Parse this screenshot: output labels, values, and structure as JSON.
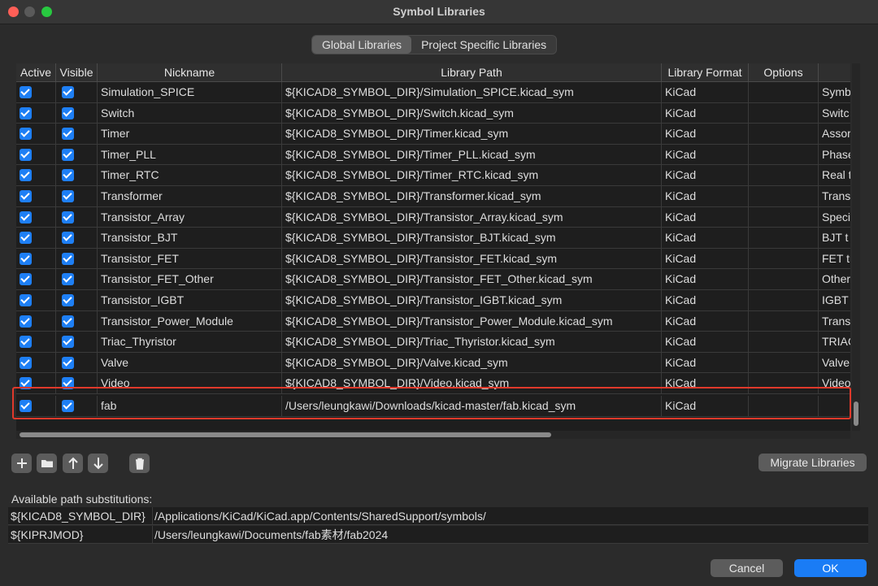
{
  "window": {
    "title": "Symbol Libraries"
  },
  "tabs": [
    {
      "label": "Global Libraries",
      "active": true
    },
    {
      "label": "Project Specific Libraries",
      "active": false
    }
  ],
  "table": {
    "columns": [
      "Active",
      "Visible",
      "Nickname",
      "Library Path",
      "Library Format",
      "Options",
      ""
    ],
    "rows": [
      {
        "active": true,
        "visible": true,
        "nickname": "Simulation_SPICE",
        "path": "${KICAD8_SYMBOL_DIR}/Simulation_SPICE.kicad_sym",
        "format": "KiCad",
        "options": "",
        "description": "Symb"
      },
      {
        "active": true,
        "visible": true,
        "nickname": "Switch",
        "path": "${KICAD8_SYMBOL_DIR}/Switch.kicad_sym",
        "format": "KiCad",
        "options": "",
        "description": "Switc"
      },
      {
        "active": true,
        "visible": true,
        "nickname": "Timer",
        "path": "${KICAD8_SYMBOL_DIR}/Timer.kicad_sym",
        "format": "KiCad",
        "options": "",
        "description": "Assor"
      },
      {
        "active": true,
        "visible": true,
        "nickname": "Timer_PLL",
        "path": "${KICAD8_SYMBOL_DIR}/Timer_PLL.kicad_sym",
        "format": "KiCad",
        "options": "",
        "description": "Phase"
      },
      {
        "active": true,
        "visible": true,
        "nickname": "Timer_RTC",
        "path": "${KICAD8_SYMBOL_DIR}/Timer_RTC.kicad_sym",
        "format": "KiCad",
        "options": "",
        "description": "Real t"
      },
      {
        "active": true,
        "visible": true,
        "nickname": "Transformer",
        "path": "${KICAD8_SYMBOL_DIR}/Transformer.kicad_sym",
        "format": "KiCad",
        "options": "",
        "description": "Trans"
      },
      {
        "active": true,
        "visible": true,
        "nickname": "Transistor_Array",
        "path": "${KICAD8_SYMBOL_DIR}/Transistor_Array.kicad_sym",
        "format": "KiCad",
        "options": "",
        "description": "Speci"
      },
      {
        "active": true,
        "visible": true,
        "nickname": "Transistor_BJT",
        "path": "${KICAD8_SYMBOL_DIR}/Transistor_BJT.kicad_sym",
        "format": "KiCad",
        "options": "",
        "description": "BJT t"
      },
      {
        "active": true,
        "visible": true,
        "nickname": "Transistor_FET",
        "path": "${KICAD8_SYMBOL_DIR}/Transistor_FET.kicad_sym",
        "format": "KiCad",
        "options": "",
        "description": "FET tr"
      },
      {
        "active": true,
        "visible": true,
        "nickname": "Transistor_FET_Other",
        "path": "${KICAD8_SYMBOL_DIR}/Transistor_FET_Other.kicad_sym",
        "format": "KiCad",
        "options": "",
        "description": "Other"
      },
      {
        "active": true,
        "visible": true,
        "nickname": "Transistor_IGBT",
        "path": "${KICAD8_SYMBOL_DIR}/Transistor_IGBT.kicad_sym",
        "format": "KiCad",
        "options": "",
        "description": "IGBT"
      },
      {
        "active": true,
        "visible": true,
        "nickname": "Transistor_Power_Module",
        "path": "${KICAD8_SYMBOL_DIR}/Transistor_Power_Module.kicad_sym",
        "format": "KiCad",
        "options": "",
        "description": "Trans"
      },
      {
        "active": true,
        "visible": true,
        "nickname": "Triac_Thyristor",
        "path": "${KICAD8_SYMBOL_DIR}/Triac_Thyristor.kicad_sym",
        "format": "KiCad",
        "options": "",
        "description": "TRIAC"
      },
      {
        "active": true,
        "visible": true,
        "nickname": "Valve",
        "path": "${KICAD8_SYMBOL_DIR}/Valve.kicad_sym",
        "format": "KiCad",
        "options": "",
        "description": "Valve"
      },
      {
        "active": true,
        "visible": true,
        "nickname": "Video",
        "path": "${KICAD8_SYMBOL_DIR}/Video.kicad_sym",
        "format": "KiCad",
        "options": "",
        "description": "Video"
      },
      {
        "active": true,
        "visible": true,
        "nickname": "fab",
        "path": "/Users/leungkawi/Downloads/kicad-master/fab.kicad_sym",
        "format": "KiCad",
        "options": "",
        "description": ""
      }
    ]
  },
  "toolbar": {
    "add_icon": "plus-icon",
    "folder_icon": "folder-icon",
    "up_icon": "arrow-up-icon",
    "down_icon": "arrow-down-icon",
    "delete_icon": "trash-icon",
    "migrate_label": "Migrate Libraries"
  },
  "substitutions": {
    "label": "Available path substitutions:",
    "items": [
      {
        "key": "${KICAD8_SYMBOL_DIR}",
        "value": "/Applications/KiCad/KiCad.app/Contents/SharedSupport/symbols/"
      },
      {
        "key": "${KIPRJMOD}",
        "value": "/Users/leungkawi/Documents/fab素材/fab2024"
      }
    ]
  },
  "buttons": {
    "cancel": "Cancel",
    "ok": "OK"
  },
  "colors": {
    "accent": "#1e7ff5",
    "highlight": "#e0392b"
  }
}
